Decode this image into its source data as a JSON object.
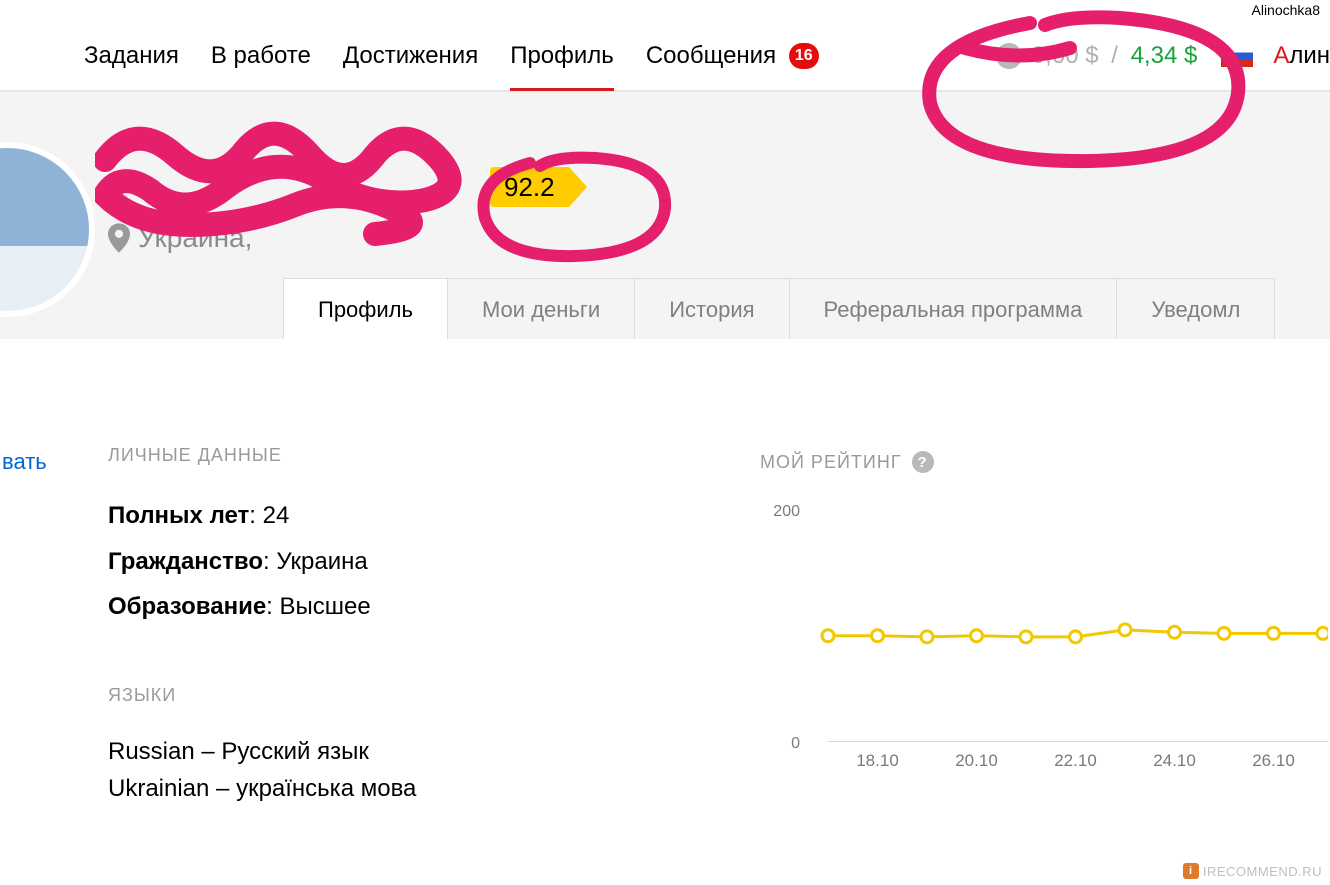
{
  "watermark_user": "Alinochka8",
  "watermark_site": "IRECOMMEND.RU",
  "nav": {
    "items": [
      "Задания",
      "В работе",
      "Достижения",
      "Профиль",
      "Сообщения"
    ],
    "active_index": 3,
    "messages_badge": "16"
  },
  "balance": {
    "zero": "0,00 $",
    "available": "4,34 $"
  },
  "user_label": {
    "first": "А",
    "rest": "лин"
  },
  "flag_country": "russia",
  "profile": {
    "country_prefix": "Украина, ",
    "rating_badge": "92.2"
  },
  "tabs": {
    "items": [
      "Профиль",
      "Мои деньги",
      "История",
      "Реферальная программа",
      "Уведомл"
    ],
    "active_index": 0
  },
  "edit_label": "вать",
  "section_personal": "ЛИЧНЫЕ ДАННЫЕ",
  "section_lang": "ЯЗЫКИ",
  "section_rating": "МОЙ РЕЙТИНГ",
  "personal": [
    {
      "label": "Полных лет",
      "value": "24"
    },
    {
      "label": "Гражданство",
      "value": "Украина"
    },
    {
      "label": "Образование",
      "value": "Высшее"
    }
  ],
  "languages": [
    "Russian – Русский язык",
    "Ukrainian – українська мова"
  ],
  "chart_data": {
    "type": "line",
    "title": "МОЙ РЕЙТИНГ",
    "xlabel": "",
    "ylabel": "",
    "ylim": [
      0,
      200
    ],
    "y_ticks": [
      0,
      200
    ],
    "x_ticks": [
      "18.10",
      "20.10",
      "22.10",
      "24.10",
      "26.10"
    ],
    "x": [
      "17.10",
      "18.10",
      "19.10",
      "20.10",
      "21.10",
      "22.10",
      "23.10",
      "24.10",
      "25.10",
      "26.10",
      "27.10"
    ],
    "values": [
      90,
      90,
      89,
      90,
      89,
      89,
      95,
      93,
      92,
      92,
      92
    ]
  },
  "colors": {
    "accent_yellow": "#ffcc00",
    "green": "#17a33a",
    "red": "#e40c0c",
    "annot": "#e51f6c"
  }
}
